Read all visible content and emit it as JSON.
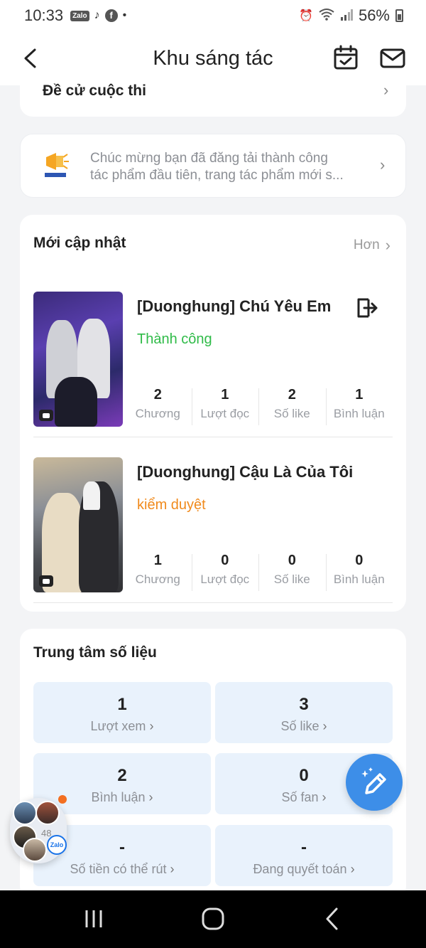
{
  "status_bar": {
    "time": "10:33",
    "battery": "56%"
  },
  "header": {
    "title": "Khu sáng tác"
  },
  "contest": {
    "label": "Đề cử cuộc thi"
  },
  "notice": {
    "line1": "Chúc mừng bạn đã đăng tải thành công",
    "line2": "tác phẩm đầu tiên, trang tác phẩm mới s..."
  },
  "updates": {
    "title": "Mới cập nhật",
    "more": "Hơn",
    "items": [
      {
        "title": "[Duonghung] Chú Yêu Em",
        "status": "Thành công",
        "stats": [
          {
            "value": "2",
            "label": "Chương"
          },
          {
            "value": "1",
            "label": "Lượt đọc"
          },
          {
            "value": "2",
            "label": "Số like"
          },
          {
            "value": "1",
            "label": "Bình luận"
          }
        ]
      },
      {
        "title": "[Duonghung] Cậu Là Của Tôi",
        "status": "kiểm duyệt",
        "stats": [
          {
            "value": "1",
            "label": "Chương"
          },
          {
            "value": "0",
            "label": "Lượt đọc"
          },
          {
            "value": "0",
            "label": "Số like"
          },
          {
            "value": "0",
            "label": "Bình luận"
          }
        ]
      }
    ]
  },
  "data_center": {
    "title": "Trung tâm số liệu",
    "tiles": [
      {
        "value": "1",
        "label": "Lượt xem"
      },
      {
        "value": "3",
        "label": "Số like"
      },
      {
        "value": "2",
        "label": "Bình luận"
      },
      {
        "value": "0",
        "label": "Số fan"
      },
      {
        "value": "-",
        "label": "Số tiền có thể rút"
      },
      {
        "value": "-",
        "label": "Đang quyết toán"
      }
    ]
  },
  "zalo_bubble": {
    "count": "48",
    "logo": "Zalo"
  },
  "colors": {
    "success": "#2fbb48",
    "review": "#f08a1c",
    "tile_bg": "#e9f2fc",
    "fab": "#3d8ee8"
  },
  "icons": {
    "back": "back-arrow-icon",
    "calendar": "calendar-check-icon",
    "mail": "mail-icon",
    "notice": "megaphone-icon",
    "export": "export-icon",
    "fab": "pencil-sparkle-icon"
  }
}
